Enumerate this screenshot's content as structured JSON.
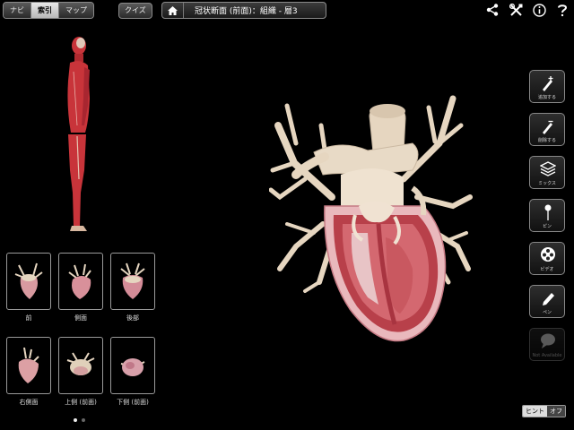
{
  "topbar": {
    "segments": [
      "ナビ",
      "索引",
      "マップ"
    ],
    "active_segment": "索引",
    "quiz_label": "クイズ",
    "breadcrumb_title": "冠状断面 (前面)：組織 - 層3",
    "icons": [
      "share-icon",
      "tools-icon",
      "info-icon",
      "help-icon"
    ]
  },
  "views": [
    {
      "label": "前"
    },
    {
      "label": "側面"
    },
    {
      "label": "後部"
    },
    {
      "label": "右側面"
    },
    {
      "label": "上側 (前面)"
    },
    {
      "label": "下側 (前面)"
    }
  ],
  "pager": {
    "pages": 2,
    "current": 1
  },
  "tools": [
    {
      "label": "追加する",
      "icon": "add-pen-icon"
    },
    {
      "label": "削除する",
      "icon": "remove-pen-icon"
    },
    {
      "label": "ミックス",
      "icon": "layers-icon"
    },
    {
      "label": "ピン",
      "icon": "pin-icon"
    },
    {
      "label": "ビデオ",
      "icon": "film-reel-icon"
    },
    {
      "label": "ペン",
      "icon": "pen-icon"
    },
    {
      "label": "Not Available",
      "icon": "speech-bubble-icon",
      "disabled": true
    }
  ],
  "hint": {
    "label": "ヒント",
    "state": "オフ"
  },
  "colors": {
    "muscle": "#c8343a",
    "tissue": "#e8d8c4",
    "myocardium": "#b8404a"
  }
}
